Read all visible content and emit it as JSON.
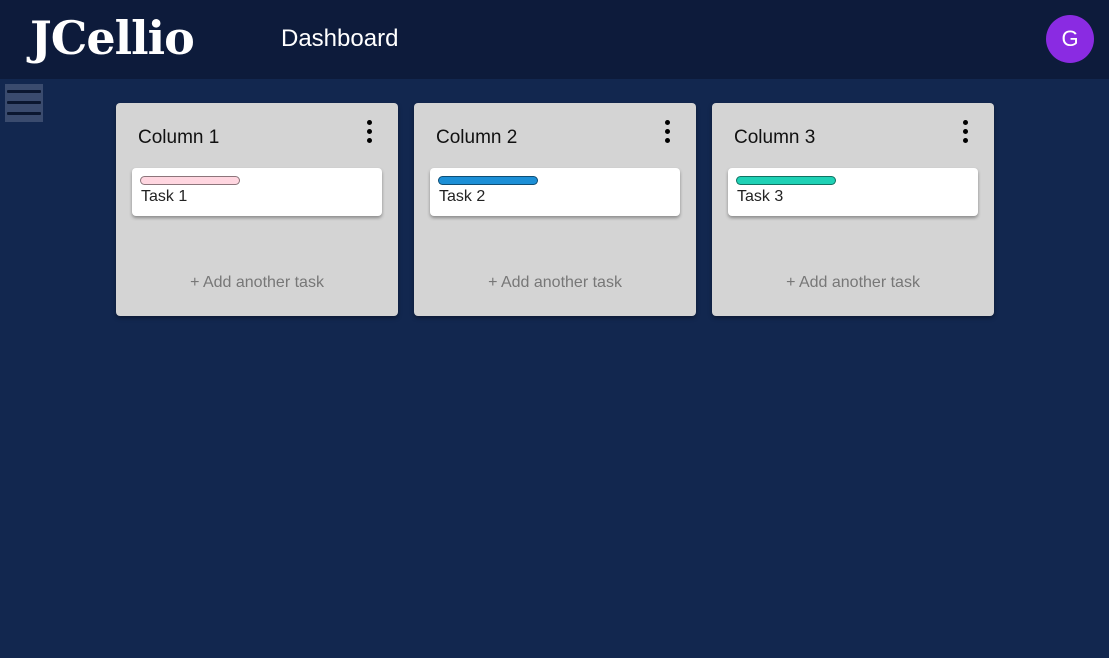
{
  "header": {
    "logo": "JCellio",
    "title": "Dashboard",
    "avatar_initial": "G",
    "avatar_color": "#8a2be2"
  },
  "sidebar_toggle": {
    "icon": "hamburger-menu-icon"
  },
  "columns": [
    {
      "title": "Column 1",
      "menu_icon": "more-vertical-icon",
      "tasks": [
        {
          "label": "Task 1",
          "tag_color": "#ffd6e0"
        }
      ],
      "add_label": "+ Add another task"
    },
    {
      "title": "Column 2",
      "menu_icon": "more-vertical-icon",
      "tasks": [
        {
          "label": "Task 2",
          "tag_color": "#1c8fd6"
        }
      ],
      "add_label": "+ Add another task"
    },
    {
      "title": "Column 3",
      "menu_icon": "more-vertical-icon",
      "tasks": [
        {
          "label": "Task 3",
          "tag_color": "#1fd1b5"
        }
      ],
      "add_label": "+ Add another task"
    }
  ]
}
